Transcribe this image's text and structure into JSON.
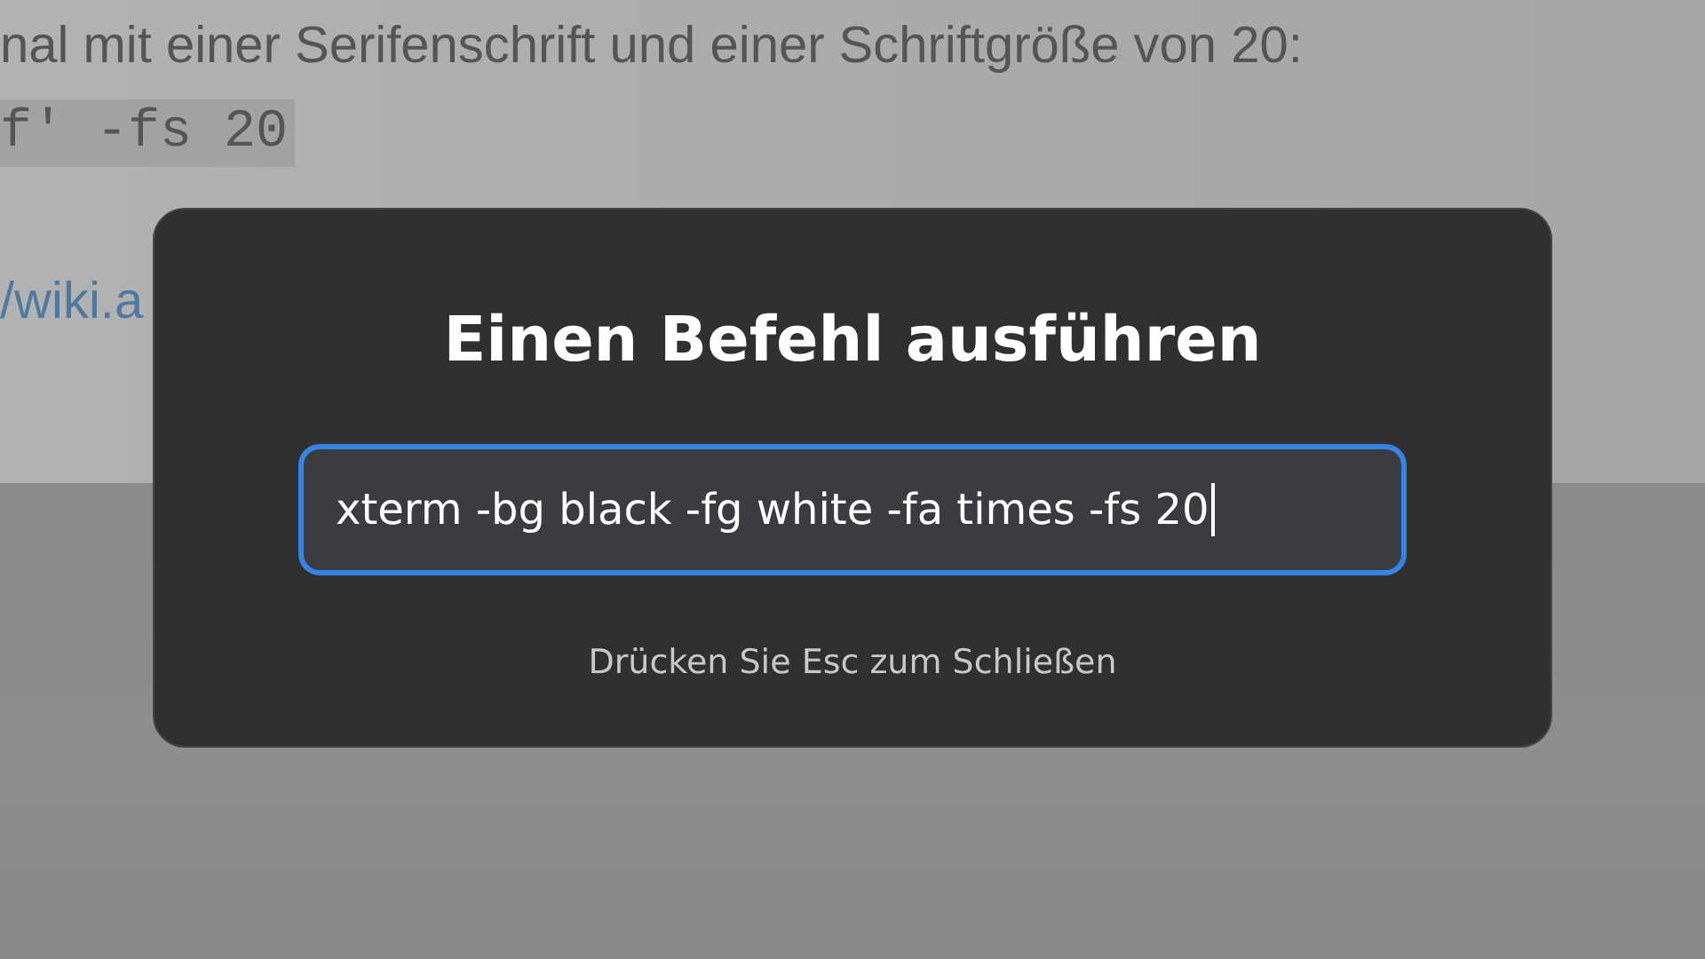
{
  "page": {
    "text": "nal mit einer Serifenschrift und einer Schriftgröße von 20:",
    "code": "f' -fs 20",
    "link": "/wiki.a"
  },
  "dialog": {
    "title": "Einen Befehl ausführen",
    "command": {
      "value": "xterm -bg black -fg white -fa times -fs 20",
      "focused": true
    },
    "hint": "Drücken Sie Esc zum Schließen"
  }
}
